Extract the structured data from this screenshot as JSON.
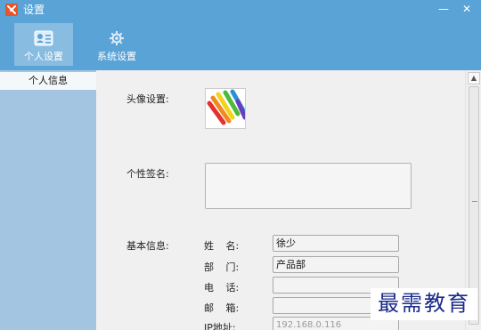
{
  "window": {
    "title": "设置",
    "minimize_glyph": "—",
    "close_glyph": "✕"
  },
  "toolbar": {
    "tabs": [
      {
        "label": "个人设置",
        "icon": "id-card-icon",
        "active": true
      },
      {
        "label": "系统设置",
        "icon": "gear-icon",
        "active": false
      }
    ]
  },
  "sidebar": {
    "items": [
      {
        "label": "个人信息",
        "selected": true
      }
    ]
  },
  "main": {
    "avatar_label": "头像设置:",
    "signature_label": "个性签名:",
    "signature_value": "",
    "basic_info_label": "基本信息:",
    "fields": [
      {
        "label_a": "姓",
        "label_b": "名:",
        "value": "徐少"
      },
      {
        "label_a": "部",
        "label_b": "门:",
        "value": "产品部"
      },
      {
        "label_a": "电",
        "label_b": "话:",
        "value": ""
      },
      {
        "label_a": "邮",
        "label_b": "箱:",
        "value": ""
      },
      {
        "label_a": "IP地址:",
        "label_b": "",
        "value": "192.168.0.116"
      }
    ]
  },
  "scrollbar": {
    "up_glyph": "▲"
  },
  "watermark": "最需教育",
  "colors": {
    "titlebar": "#5aa3d6",
    "sidebar": "#a3c5e1",
    "content": "#f0f0f0",
    "watermark": "#1a2a8a"
  }
}
